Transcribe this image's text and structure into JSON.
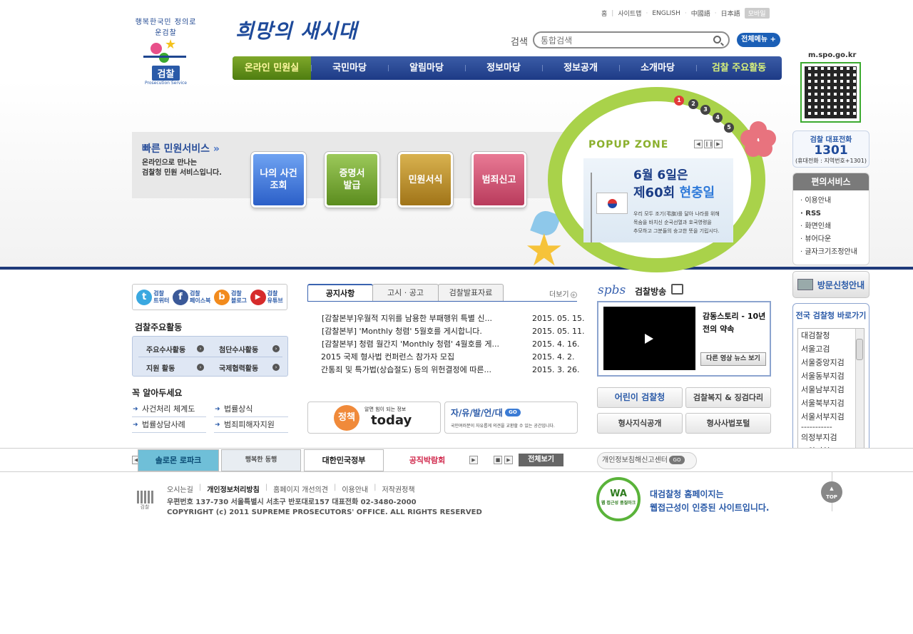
{
  "header": {
    "logo_arc": "행복한국민 정의로운검찰",
    "logo_name": "검찰",
    "logo_sub": "Prosecution Service",
    "slogan": "희망의 새시대",
    "utility": [
      "홈",
      "사이트맵",
      "ENGLISH",
      "中國語",
      "日本語"
    ],
    "mobile": "모바일",
    "search_label": "검색",
    "search_placeholder": "통합검색",
    "full_menu": "전체메뉴 +"
  },
  "gnb": [
    "온라인 민원실",
    "국민마당",
    "알림마당",
    "정보마당",
    "정보공개",
    "소개마당",
    "검찰 주요활동"
  ],
  "quick_service": {
    "title": "빠른 민원서비스",
    "desc_line1": "온라인으로 만나는",
    "desc_line2": "검찰청 민원 서비스입니다.",
    "buttons": [
      {
        "line1": "나의 사건",
        "line2": "조회"
      },
      {
        "line1": "증명서",
        "line2": "발급"
      },
      {
        "line1": "민원서식",
        "line2": ""
      },
      {
        "line1": "범죄신고",
        "line2": ""
      }
    ]
  },
  "popup": {
    "title": "POPUP ZONE",
    "pages": [
      "1",
      "2",
      "3",
      "4",
      "5"
    ],
    "active_page": 1,
    "headline1": "6월 6일은",
    "headline2a": "제60회 ",
    "headline2b": "현충일",
    "body1": "우리 모두 조기(弔旗)를 달아 나라를 위해",
    "body2": "목숨을 바치신 순국선열과 호국영령을",
    "body3": "추모하고 그분들의 숭고한 뜻을 기립시다."
  },
  "right_side": {
    "qr_label": "m.spo.go.kr",
    "phone_title": "검찰 대표전화",
    "phone_number": "1301",
    "phone_note": "(휴대전화 : 지역번호+1301)",
    "convenience_title": "편의서비스",
    "convenience_items": [
      "이용안내",
      "RSS",
      "화면인쇄",
      "뷰어다운",
      "글자크기조정안내"
    ],
    "visit_label": "방문신청안내",
    "branch_title": "전국 검찰청 바로가기",
    "branches": [
      "대검찰청",
      "서울고검",
      "서울중앙지검",
      "서울동부지검",
      "서울남부지검",
      "서울북부지검",
      "서울서부지검",
      "-----------",
      "의정부지검",
      "고양지청"
    ]
  },
  "social": [
    {
      "letter": "t",
      "label1": "검찰",
      "label2": "트위터",
      "color": "#3aa8e0"
    },
    {
      "letter": "f",
      "label1": "검찰",
      "label2": "페이스북",
      "color": "#3b5998"
    },
    {
      "letter": "b",
      "label1": "검찰",
      "label2": "블로그",
      "color": "#f28b1d"
    },
    {
      "letter": "▶",
      "label1": "검찰",
      "label2": "유튜브",
      "color": "#d62b2b"
    }
  ],
  "major_activities": {
    "title": "검찰주요활동",
    "items": [
      "주요수사활동",
      "첨단수사활동",
      "지원 활동",
      "국제협력활동"
    ]
  },
  "must_know": {
    "title": "꼭 알아두세요",
    "items": [
      "사건처리 체계도",
      "법률상식",
      "법률상담사례",
      "범죄피해자지원"
    ]
  },
  "notice": {
    "tabs": [
      "공지사항",
      "고시 · 공고",
      "검찰발표자료"
    ],
    "more": "더보기",
    "rows": [
      {
        "title": "[감찰본부]우월적 지위를 남용한 부패행위 특별 신...",
        "date": "2015. 05. 15."
      },
      {
        "title": "[감찰본부] 'Monthly 청렴' 5월호를 게시합니다.",
        "date": "2015. 05. 11."
      },
      {
        "title": "[감찰본부] 청렴 월간지 'Monthly 청렴' 4월호를 게...",
        "date": "2015. 4. 16."
      },
      {
        "title": "2015 국제 형사법 컨퍼런스 참가자 모집",
        "date": "2015. 4. 2."
      },
      {
        "title": "간통죄 및 특가법(상습절도) 등의 위헌결정에 따른...",
        "date": "2015. 3. 26."
      }
    ]
  },
  "banners": {
    "policy_circle": "정책",
    "policy_small": "알면 힘이 되는 정보",
    "policy_big": "today",
    "free_big": "자/유/발/언/대",
    "free_go": "GO",
    "free_small": "국민여러분이 자유롭게 의견을 교환할 수 있는 공간입니다."
  },
  "spbs": {
    "logo": "spbs",
    "title": "검찰방송",
    "video_title1": "감동스토리 - 10년",
    "video_title2": "전의 약속",
    "video_btn": "다른 영상 뉴스 보기"
  },
  "gray_buttons": [
    "어린이 검찰청",
    "검찰복지 & 징검다리",
    "형사지식공개",
    "형사사법포털"
  ],
  "banner_strip": {
    "items": [
      "솔로몬 로파크",
      "행복한 동행",
      "대한민국정부",
      "공직박람회"
    ],
    "all": "전체보기",
    "privacy": "개인정보침해신고센터",
    "privacy_go": "GO"
  },
  "footer": {
    "logo_text": "검찰",
    "links": [
      "오시는길",
      "개인정보처리방침",
      "홈페이지 개선의견",
      "이용안내",
      "저작권정책"
    ],
    "address": "우편번호 137-730 서울특별시 서초구 반포대로157  대표전화 02-3480-2000",
    "copyright": "COPYRIGHT (c) 2011 SUPREME PROSECUTORS' OFFICE. ALL RIGHTS RESERVED",
    "wa_mark": "WA",
    "wa_sub": "웹 접근성 품질마크",
    "wa_text1": "대검찰청 홈페이지는",
    "wa_text2": "웹접근성이 인증된 사이트입니다.",
    "top": "TOP"
  }
}
